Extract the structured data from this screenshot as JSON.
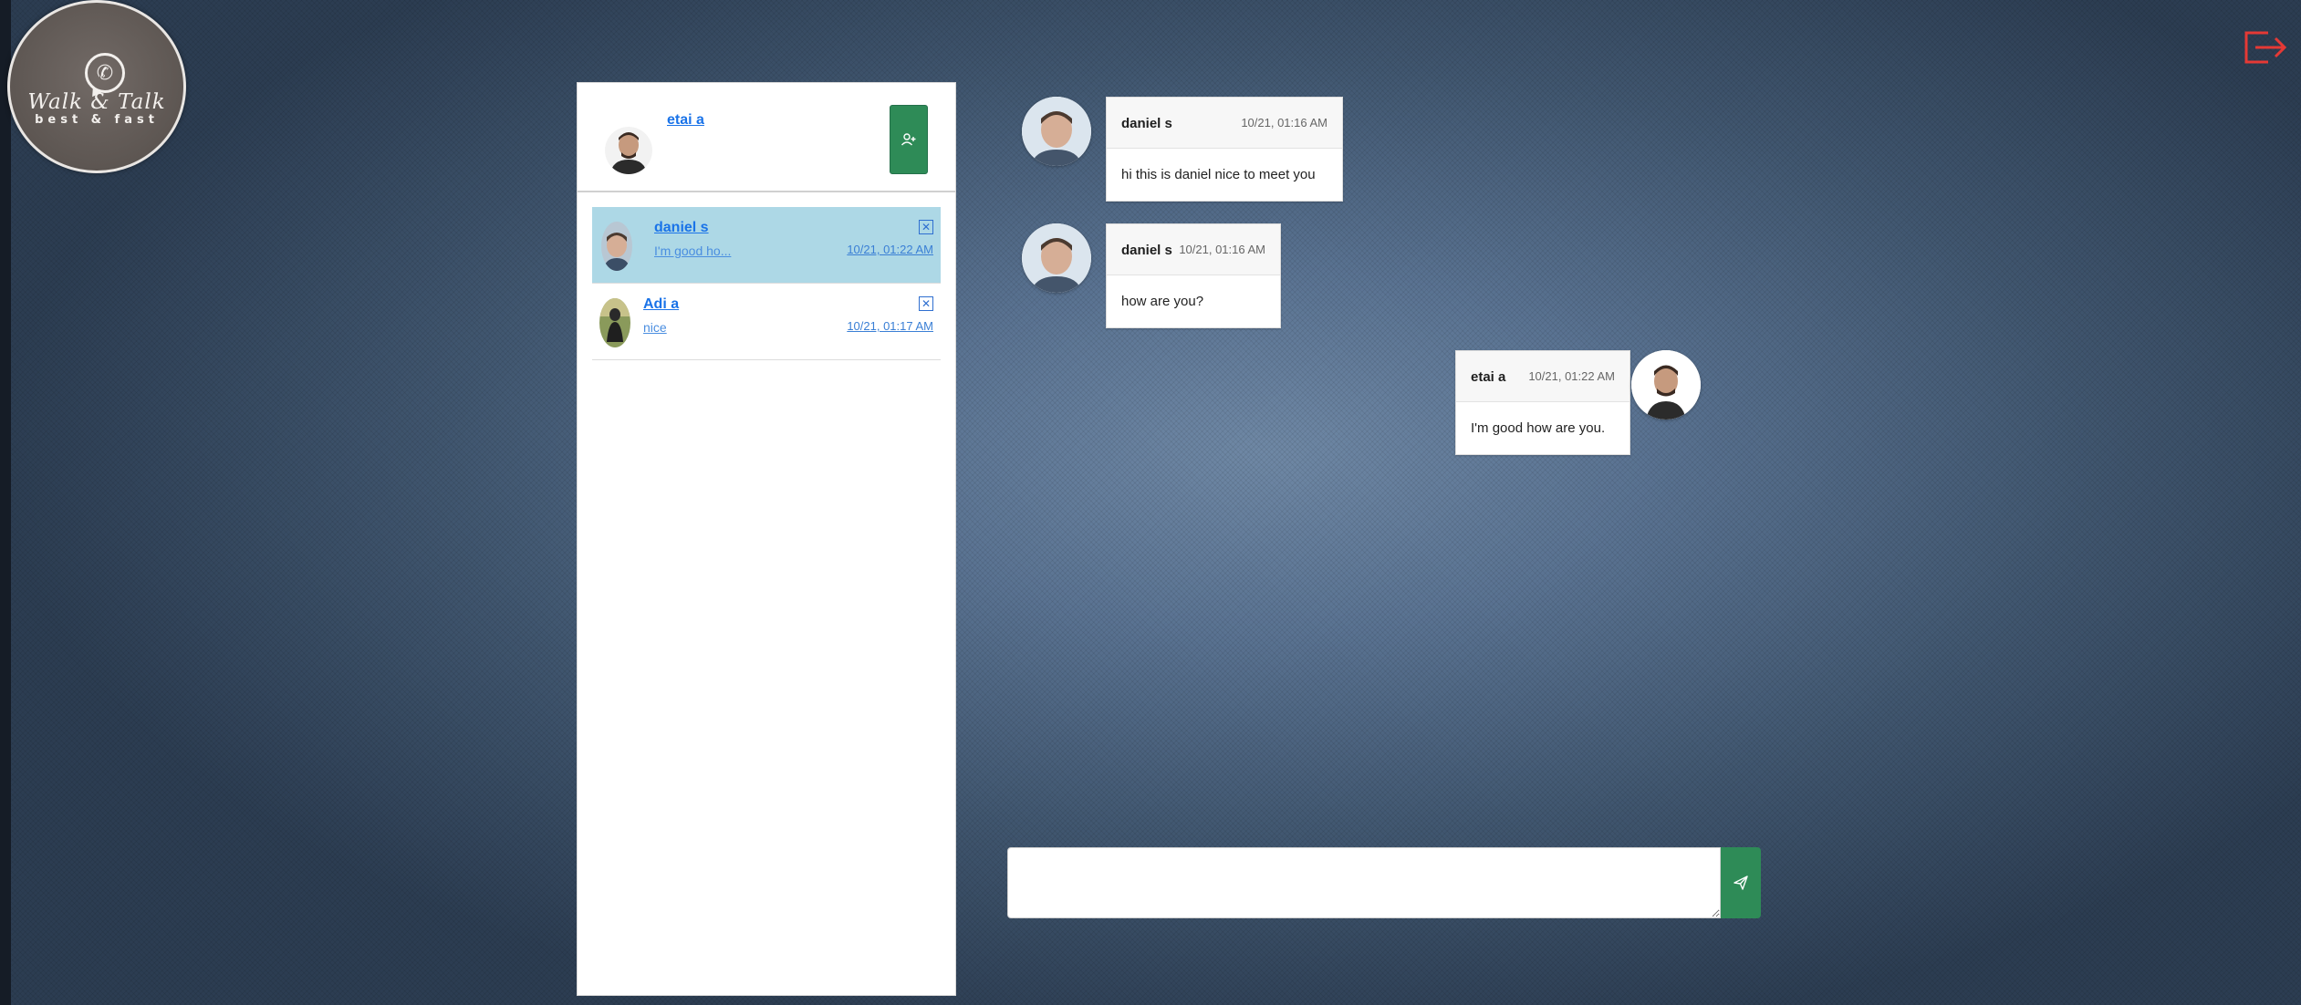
{
  "logo": {
    "title": "Walk & Talk",
    "subtitle": "best & fast",
    "icon": "phone-chat-icon"
  },
  "header": {
    "logout_icon": "logout-icon",
    "logout_color": "#e53935"
  },
  "sidebar": {
    "current_user": {
      "name": "etai a",
      "avatar": "user-avatar"
    },
    "add_contact_icon": "add-user-icon",
    "contacts": [
      {
        "name": "daniel s",
        "last_message": "I'm good ho...",
        "time": "10/21, 01:22 AM",
        "active": true
      },
      {
        "name": "Adi a",
        "last_message": "nice",
        "time": "10/21, 01:17 AM",
        "active": false
      }
    ],
    "close_glyph": "✕"
  },
  "messages": [
    {
      "author": "daniel s",
      "time": "10/21, 01:16 AM",
      "text": "hi this is daniel nice to meet you",
      "side": "left"
    },
    {
      "author": "daniel s",
      "time": "10/21, 01:16 AM",
      "text": "how are you?",
      "side": "left"
    },
    {
      "author": "etai a",
      "time": "10/21, 01:22 AM",
      "text": "I'm good how are you.",
      "side": "right"
    }
  ],
  "composer": {
    "value": "",
    "placeholder": "",
    "send_icon": "send-icon"
  },
  "colors": {
    "accent": "#2e8b57",
    "active_contact": "#add8e6",
    "link": "#1a73e8"
  }
}
